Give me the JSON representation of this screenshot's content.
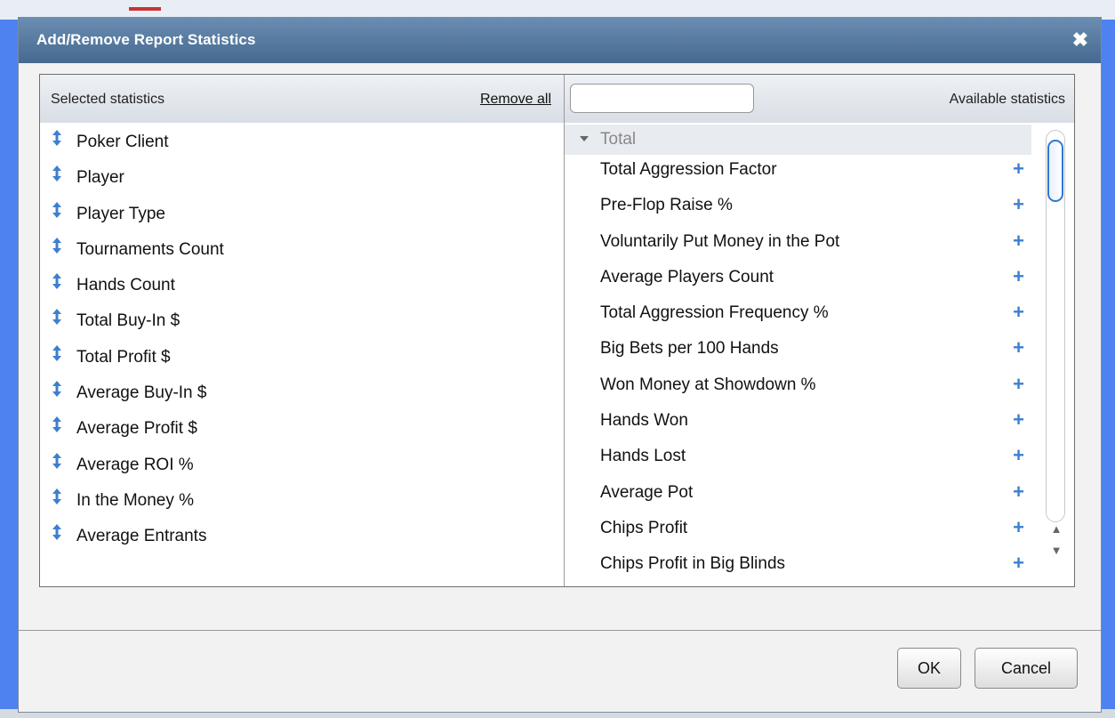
{
  "dialog": {
    "title": "Add/Remove Report Statistics",
    "close_glyph": "✖"
  },
  "selected": {
    "header": "Selected statistics",
    "remove_all": "Remove all",
    "drag_icon": "drag-handle-icon",
    "items": [
      "Poker Client",
      "Player",
      "Player Type",
      "Tournaments Count",
      "Hands Count",
      "Total Buy-In $",
      "Total Profit $",
      "Average Buy-In $",
      "Average Profit $",
      "Average ROI %",
      "In the Money %",
      "Average Entrants"
    ]
  },
  "available": {
    "header": "Available statistics",
    "search_value": "",
    "group": "Total",
    "add_glyph": "+",
    "items": [
      "Total Aggression Factor",
      "Pre-Flop Raise %",
      "Voluntarily Put Money in the Pot",
      "Average Players Count",
      "Total Aggression Frequency %",
      "Big Bets per 100 Hands",
      "Won Money at Showdown %",
      "Hands Won",
      "Hands Lost",
      "Average Pot",
      "Chips Profit",
      "Chips Profit in Big Blinds"
    ]
  },
  "buttons": {
    "ok": "OK",
    "cancel": "Cancel"
  },
  "colors": {
    "accent": "#3c7fd0",
    "titlebar": "#45698f"
  }
}
